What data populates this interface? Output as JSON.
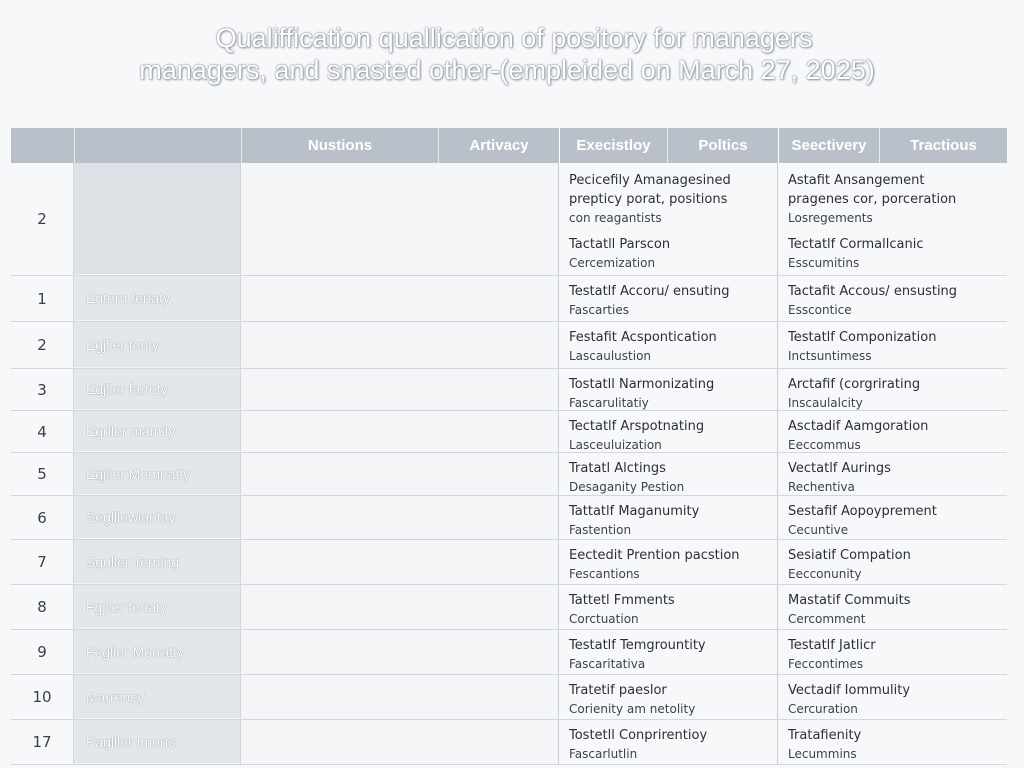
{
  "title": {
    "line1": "Qualiffication quallication of pository for managers",
    "line2": "managers, and snasted other-(empleided on March 27, 2025)"
  },
  "headers": [
    "",
    "",
    "Nustions",
    "Artivacy",
    "Execistloy",
    "Poltics",
    "Seectivery",
    "Tractious"
  ],
  "first_row": {
    "num": "2",
    "exec": {
      "lines": [
        "Pecicefily Amanagesined",
        "prepticy porat, positions",
        "con reagantists"
      ],
      "t2": "Tactatll Parscon",
      "s2": "Cercemization"
    },
    "sec": {
      "lines": [
        "Astafit Ansangement",
        "pragenes cor, porceration",
        "Losregements"
      ],
      "t2": "Tectatlf Cormallcanic",
      "s2": "Esscumitins"
    }
  },
  "rows": [
    {
      "num": "1",
      "label": "Entern fertaty",
      "exec_t": "Testatlf Accoru/ ensuting",
      "exec_s": "Fascarties",
      "sec_t": "Tactafit Accous/ ensusting",
      "sec_s": "Esscontice"
    },
    {
      "num": "2",
      "label": "Egjller fenty",
      "exec_t": "Festafit Acspontication",
      "exec_s": "Lascaulustion",
      "sec_t": "Testatlf Componization",
      "sec_s": "Inctsuntimess"
    },
    {
      "num": "3",
      "label": "Egjller fartety",
      "exec_t": "Tostatll Narmonizating",
      "exec_s": "Fascarulitatiy",
      "sec_t": "Arctafif (corgrirating",
      "sec_s": "Inscaulalcity"
    },
    {
      "num": "4",
      "label": "Egrller mamity",
      "exec_t": "Tectatlf Arspotnating",
      "exec_s": "Lasceuluization",
      "sec_t": "Asctadif Aamgoration",
      "sec_s": "Eeccommus"
    },
    {
      "num": "5",
      "label": "Egjller Momnatty",
      "exec_t": "Tratatl Alctings",
      "exec_s": "Desaganity Pestion",
      "sec_t": "Vectatlf Aurings",
      "sec_s": "Rechentiva"
    },
    {
      "num": "6",
      "label": "Seglllewiantay",
      "exec_t": "Tattatlf Maganumity",
      "exec_s": "Fastention",
      "sec_t": "Sestafif Aopoyprement",
      "sec_s": "Cecuntive"
    },
    {
      "num": "7",
      "label": "Sguller Terning",
      "exec_t": "Eectedit Prention pacstion",
      "exec_s": "Fescantions",
      "sec_t": "Sesiatif Compation",
      "sec_s": "Eecconunity"
    },
    {
      "num": "8",
      "label": "Fgjller fertaty",
      "exec_t": "Tattetl Fmments",
      "exec_s": "Corctuation",
      "sec_t": "Mastatif Commuits",
      "sec_s": "Cercomment"
    },
    {
      "num": "9",
      "label": "Fegller Morratty",
      "exec_t": "Testatlf Temgrountity",
      "exec_s": "Fascaritativa",
      "sec_t": "Testatlf Jatlicr",
      "sec_s": "Feccontimes"
    },
    {
      "num": "10",
      "label": "Marrency",
      "exec_t": "Tratetif paeslor",
      "exec_s": "Corienity am netolity",
      "sec_t": "Vectadif Iommulity",
      "sec_s": "Cercuration"
    },
    {
      "num": "17",
      "label": "Paglller Imerts",
      "exec_t": "Tostetll Conprirentioy",
      "exec_s": "Fascarlutlin",
      "sec_t": "Tratafienity",
      "sec_s": "Lecummins"
    }
  ]
}
